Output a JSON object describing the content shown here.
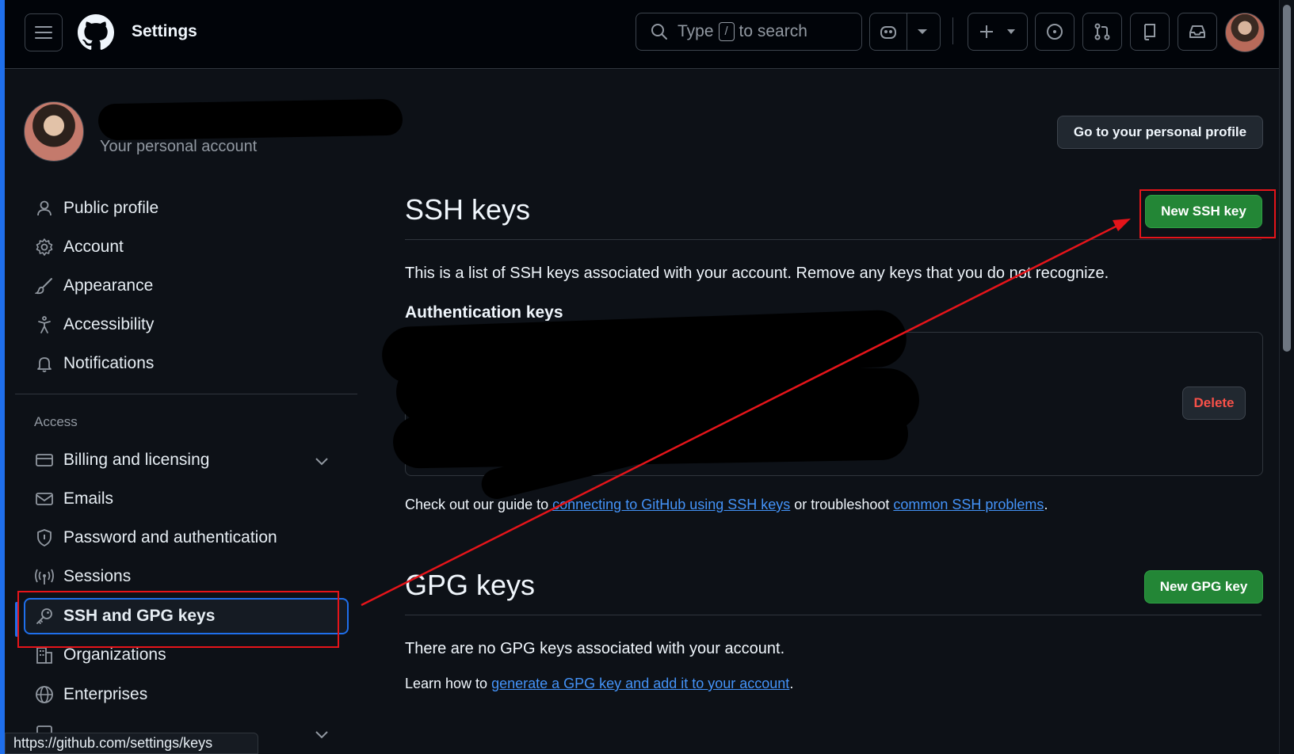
{
  "header": {
    "title": "Settings",
    "search": {
      "prefix": "Type",
      "key": "/",
      "suffix": "to search"
    }
  },
  "account": {
    "subtitle": "Your personal account",
    "profile_button": "Go to your personal profile"
  },
  "sidebar": {
    "items": [
      {
        "label": "Public profile",
        "icon": "person-icon"
      },
      {
        "label": "Account",
        "icon": "gear-icon"
      },
      {
        "label": "Appearance",
        "icon": "paintbrush-icon"
      },
      {
        "label": "Accessibility",
        "icon": "accessibility-icon"
      },
      {
        "label": "Notifications",
        "icon": "bell-icon"
      }
    ],
    "access_heading": "Access",
    "access_items": [
      {
        "label": "Billing and licensing",
        "icon": "credit-card-icon",
        "expandable": true
      },
      {
        "label": "Emails",
        "icon": "mail-icon"
      },
      {
        "label": "Password and authentication",
        "icon": "shield-icon"
      },
      {
        "label": "Sessions",
        "icon": "broadcast-icon"
      },
      {
        "label": "SSH and GPG keys",
        "icon": "key-icon",
        "active": true
      },
      {
        "label": "Organizations",
        "icon": "organization-icon"
      },
      {
        "label": "Enterprises",
        "icon": "globe-icon"
      }
    ]
  },
  "ssh": {
    "title": "SSH keys",
    "new_button": "New SSH key",
    "description": "This is a list of SSH keys associated with your account. Remove any keys that you do not recognize.",
    "auth_heading": "Authentication keys",
    "delete_button": "Delete",
    "guide_prefix": "Check out our guide to ",
    "guide_link1": "connecting to GitHub using SSH keys",
    "guide_middle": " or troubleshoot ",
    "guide_link2": "common SSH problems",
    "guide_suffix": "."
  },
  "gpg": {
    "title": "GPG keys",
    "new_button": "New GPG key",
    "empty_text": "There are no GPG keys associated with your account.",
    "learn_prefix": "Learn how to ",
    "learn_link": "generate a GPG key and add it to your account",
    "learn_suffix": "."
  },
  "statusbar": {
    "url": "https://github.com/settings/keys"
  },
  "colors": {
    "accent": "#1f6feb",
    "primary_button": "#238636",
    "danger": "#f85149",
    "annotation": "#e5141a"
  }
}
